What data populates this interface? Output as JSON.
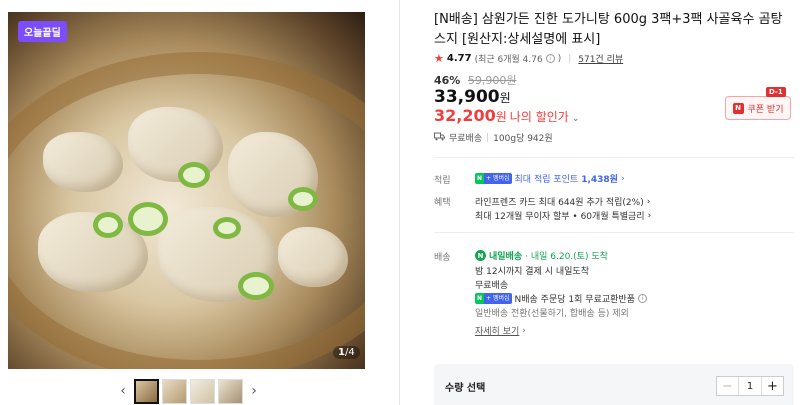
{
  "gallery": {
    "badge": "오늘끝딜",
    "counter_current": "1",
    "counter_total": "/4",
    "prev_icon": "chevron-left-icon",
    "next_icon": "chevron-right-icon"
  },
  "product": {
    "title": "[N배송] 삼원가든 진한 도가니탕 600g 3팩+3팩 사골육수 곰탕 스지 [원산지:상세설명에 표시]",
    "rating_star": "★",
    "rating": "4.77",
    "rating_recent": "(최근 6개월 4.76",
    "rating_info": "i",
    "rating_close": ")",
    "review_count": "571건 리뷰",
    "discount_pct": "46%",
    "original_price": "59,900원",
    "price": "33,900",
    "price_unit": "원",
    "my_price": "32,200",
    "my_price_unit": "원",
    "my_price_label": "나의 할인가",
    "my_price_chevron": "⌄",
    "coupon_label": "쿠폰 받기",
    "coupon_logo": "N",
    "dday": "D-1",
    "shipping": "무료배송",
    "unit_price": "100g당 942원"
  },
  "benefits": {
    "points_label": "적립",
    "membership_n": "N",
    "membership_m": "+ 멤버십",
    "points_text": "최대 적립 포인트",
    "points_value": "1,438원",
    "benefit_label": "혜택",
    "card_benefit": "라인프렌즈 카드 최대 644원 추가 적립(2%)",
    "installment": "최대 12개월 무이자 할부 • 60개월 특별금리",
    "chevron": "›"
  },
  "delivery": {
    "label": "배송",
    "tomorrow_tag": "내일배송",
    "tomorrow_date": "· 내일 6.20.(토) 도착",
    "cutoff": "밤 12시까지 결제 시 내일도착",
    "fee": "무료배송",
    "return_text": "N배송 주문당 1회 무료교환반품",
    "excluded": "일반배송 전환(선물하기, 합배송 등) 제외",
    "more_link": "자세히 보기"
  },
  "quantity": {
    "label": "수량 선택",
    "minus": "−",
    "value": "1",
    "plus": "+"
  }
}
